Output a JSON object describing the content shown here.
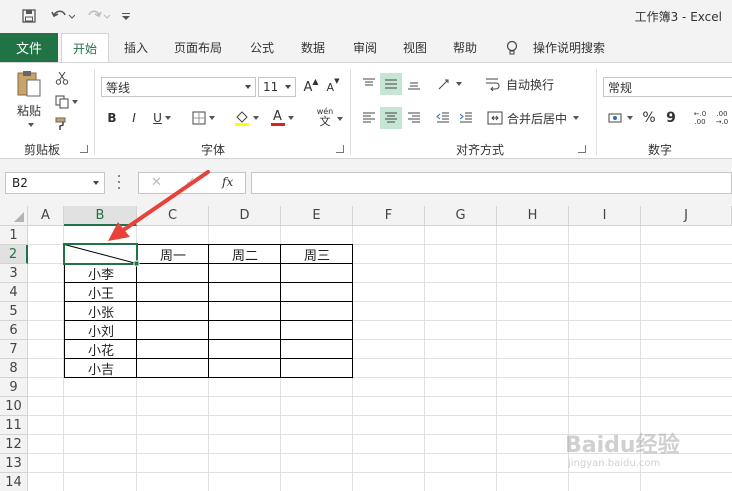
{
  "window": {
    "title": "工作簿3  -  Excel"
  },
  "tabs": [
    {
      "label": "文件"
    },
    {
      "label": "开始"
    },
    {
      "label": "插入"
    },
    {
      "label": "页面布局"
    },
    {
      "label": "公式"
    },
    {
      "label": "数据"
    },
    {
      "label": "审阅"
    },
    {
      "label": "视图"
    },
    {
      "label": "帮助"
    },
    {
      "label": "操作说明搜索"
    }
  ],
  "ribbon": {
    "clipboard": {
      "paste_label": "粘贴",
      "group_label": "剪贴板"
    },
    "font": {
      "font_name": "等线",
      "font_size": "11",
      "bold": "B",
      "italic": "I",
      "underline": "U",
      "group_label": "字体",
      "phonetic_top": "wén",
      "phonetic_bottom": "文",
      "grow": "A",
      "shrink": "A",
      "font_color_glyph": "A"
    },
    "alignment": {
      "wrap_label": "自动换行",
      "merge_label": "合并后居中",
      "group_label": "对齐方式"
    },
    "number": {
      "format": "常规",
      "percent": "%",
      "comma": "9",
      "inc_decimal_top": "←.0",
      "inc_decimal_bottom": ".00",
      "dec_decimal_top": ".00",
      "dec_decimal_bottom": "→.0",
      "group_label": "数字"
    }
  },
  "formula_bar": {
    "name_box": "B2",
    "cancel": "✕",
    "enter": "✓",
    "fx": "fx",
    "formula": ""
  },
  "columns": [
    "A",
    "B",
    "C",
    "D",
    "E",
    "F",
    "G",
    "H",
    "I",
    "J"
  ],
  "rows": [
    "1",
    "2",
    "3",
    "4",
    "5",
    "6",
    "7",
    "8",
    "9",
    "10",
    "11",
    "12",
    "13",
    "14"
  ],
  "selected": {
    "column": "B",
    "row": "2"
  },
  "table": {
    "header": [
      "",
      "周一",
      "周二",
      "周三"
    ],
    "names": [
      "小李",
      "小王",
      "小张",
      "小刘",
      "小花",
      "小吉"
    ]
  },
  "colors": {
    "excel_green": "#217346",
    "annotation_arrow": "#e8413a",
    "highlight": "#c6e5d3"
  },
  "watermark": {
    "text": "Baidu经验",
    "sub": "jingyan.baidu.com"
  }
}
